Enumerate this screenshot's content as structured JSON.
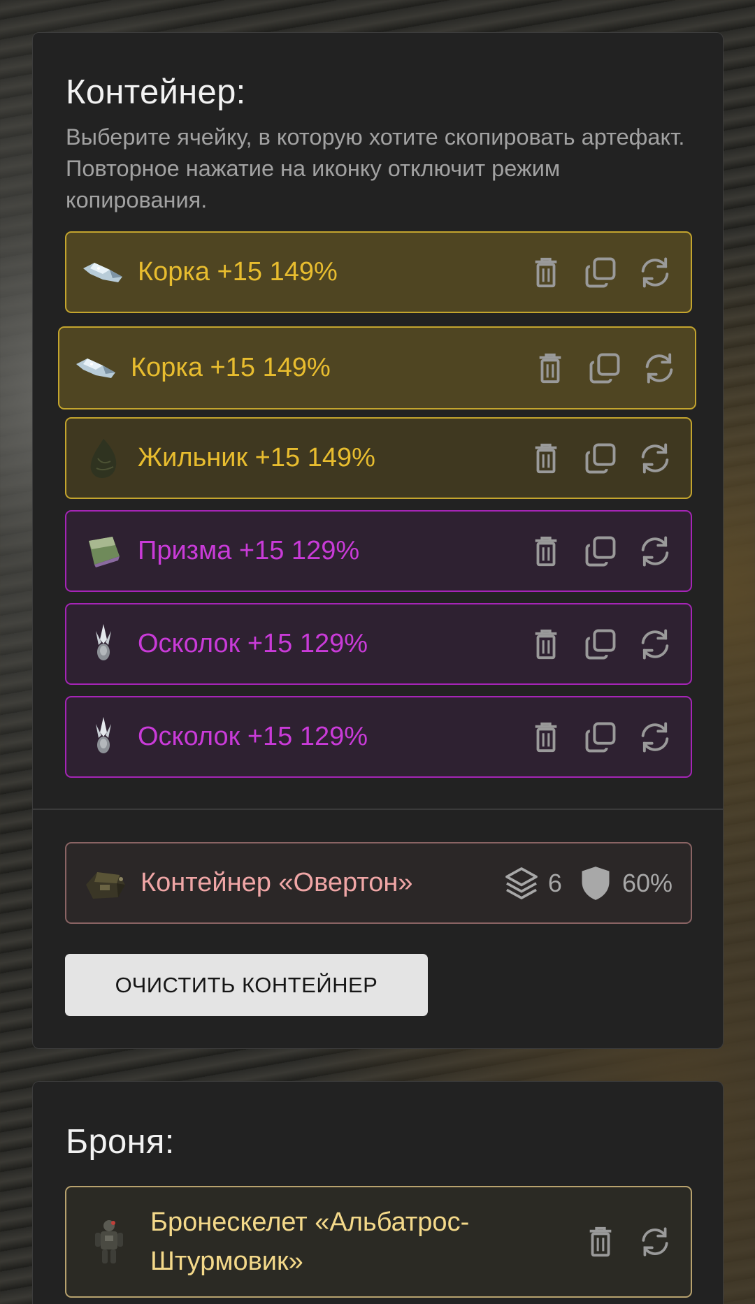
{
  "container_panel": {
    "title": "Контейнер:",
    "description": "Выберите ячейку, в которую хотите скопировать артефакт. Повторное нажатие на иконку отключит режим копирования.",
    "slots": [
      {
        "label": "Корка +15 149%",
        "rarity": "gold",
        "icon": "korka-artifact-icon"
      },
      {
        "label": "Корка +15 149%",
        "rarity": "gold",
        "icon": "korka-artifact-icon",
        "selected": true
      },
      {
        "label": "Жильник +15 149%",
        "rarity": "gold",
        "icon": "zhilnik-artifact-icon"
      },
      {
        "label": "Призма +15 129%",
        "rarity": "purple",
        "icon": "prizma-artifact-icon"
      },
      {
        "label": "Осколок +15 129%",
        "rarity": "purple",
        "icon": "oskolok-artifact-icon"
      },
      {
        "label": "Осколок +15 129%",
        "rarity": "purple",
        "icon": "oskolok-artifact-icon"
      }
    ],
    "container_item": {
      "label": "Контейнер «Овертон»",
      "slots_count": "6",
      "protection": "60%"
    },
    "clear_button": "ОЧИСТИТЬ КОНТЕЙНЕР"
  },
  "armor_panel": {
    "title": "Броня:",
    "item": {
      "label": "Бронескелет «Альбатрос-Штурмовик»"
    }
  },
  "colors": {
    "gold_text": "#e8bd2f",
    "gold_border": "#c4a52e",
    "purple_text": "#c93bd8",
    "purple_border": "#a525b6",
    "container_text": "#f0a6a6",
    "armor_text": "#f4d98a"
  }
}
